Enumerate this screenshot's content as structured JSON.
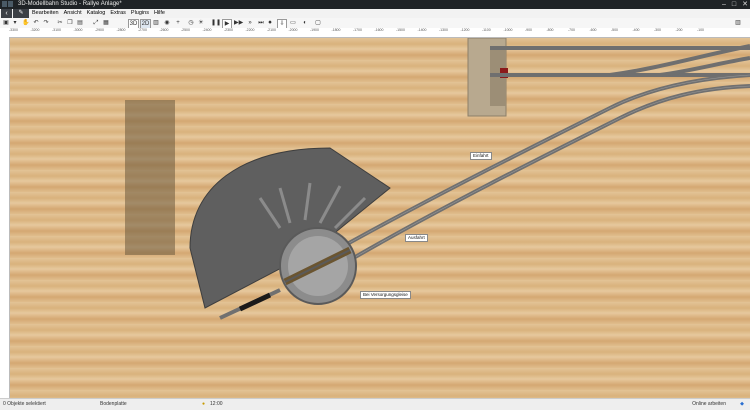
{
  "window": {
    "title": "3D-Modellbahn Studio - Rallye Anlage*"
  },
  "menu": {
    "items": [
      "Bearbeiten",
      "Ansicht",
      "Katalog",
      "Extras",
      "Plugins",
      "Hilfe"
    ]
  },
  "toolbar": {
    "view_3d": "3D",
    "view_2d": "2D"
  },
  "ruler": {
    "top_ticks": [
      "-3300",
      "-3200",
      "-3100",
      "-3000",
      "-2900",
      "-2800",
      "-2700",
      "-2600",
      "-2500",
      "-2400",
      "-2300",
      "-2200",
      "-2100",
      "-2000",
      "-1900",
      "-1800",
      "-1700",
      "-1600",
      "-1500",
      "-1400",
      "-1300",
      "-1200",
      "-1100",
      "-1000",
      "-900",
      "-800",
      "-700",
      "-600",
      "-500",
      "-400",
      "-300",
      "-200",
      "-100"
    ]
  },
  "labels": {
    "einfahrt": "Einfahrt",
    "ausfahrt": "Ausfahrt",
    "versorgung": "Bei Versorgungsgleise"
  },
  "status": {
    "selection": "0 Objekte selektiert",
    "layer": "Bodenplatte",
    "time": "12:00",
    "online": "Online arbeiten"
  }
}
